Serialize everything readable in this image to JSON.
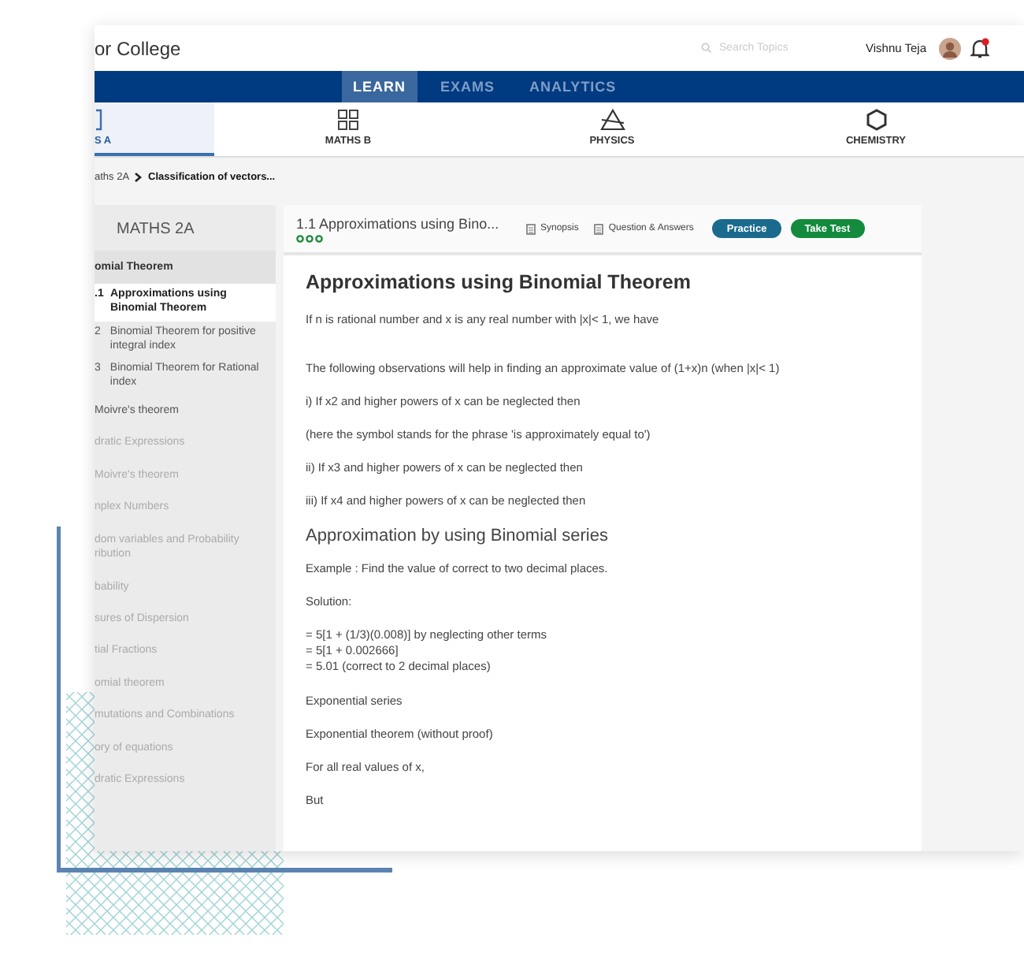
{
  "header": {
    "brand": "or College",
    "search": {
      "placeholder": "Search Topics"
    },
    "user": "Vishnu Teja",
    "notification": true
  },
  "nav_tabs": [
    {
      "label": "LEARN",
      "selected": true
    },
    {
      "label": "EXAMS",
      "selected": false
    },
    {
      "label": "ANALYTICS",
      "selected": false
    }
  ],
  "subjects": [
    {
      "label": "S A",
      "selected": true
    },
    {
      "label": "MATHS B",
      "selected": false
    },
    {
      "label": "PHYSICS",
      "selected": false
    },
    {
      "label": "CHEMISTRY",
      "selected": false
    }
  ],
  "breadcrumb": [
    "aths 2A",
    "Classification of vectors..."
  ],
  "sidebar": {
    "title": "MATHS 2A",
    "items": [
      {
        "label": "omial Theorem",
        "expanded": true,
        "children": [
          {
            "number": ".1",
            "label": "Approximations using Binomial Theorem",
            "selected": true
          },
          {
            "number": "2",
            "label": "Binomial Theorem for positive integral index",
            "selected": false
          },
          {
            "number": "3",
            "label": "Binomial Theorem for Rational index",
            "selected": false
          }
        ]
      },
      {
        "label": "Moivre's theorem",
        "expanded": false,
        "disabled": false
      },
      {
        "label": "dratic Expressions",
        "expanded": false,
        "disabled": true
      },
      {
        "label": "Moivre's theorem",
        "expanded": false,
        "disabled": true
      },
      {
        "label": "nplex Numbers",
        "expanded": false,
        "disabled": true
      },
      {
        "label": "dom variables and Probability",
        "label_2": "ribution",
        "expanded": false,
        "disabled": true
      },
      {
        "label": "bability",
        "expanded": false,
        "disabled": true
      },
      {
        "label": "sures of Dispersion",
        "expanded": false,
        "disabled": true
      },
      {
        "label": "tial Fractions",
        "expanded": false,
        "disabled": true
      },
      {
        "label": "omial theorem",
        "expanded": false,
        "disabled": true
      },
      {
        "label": "mutations and Combinations",
        "expanded": false,
        "disabled": true
      },
      {
        "label": "ory of equations",
        "expanded": false,
        "disabled": true
      },
      {
        "label": "dratic Expressions",
        "expanded": false,
        "disabled": true
      }
    ]
  },
  "lesson": {
    "title": "1.1 Approximations using Bino...",
    "links": [
      "Synopsis",
      "Question & Answers"
    ],
    "buttons": [
      {
        "label": "Practice",
        "kind": "practice"
      },
      {
        "label": "Take Test",
        "kind": "test"
      }
    ],
    "content": [
      {
        "kind": "h1",
        "text": "Approximations using Binomial Theorem"
      },
      {
        "kind": "p",
        "text": "If n is rational number and x is any real number with |x|< 1, we have"
      },
      {
        "kind": "p",
        "text": "The following observations will help in finding an approximate value of (1+x)n (when |x|< 1)"
      },
      {
        "kind": "p",
        "text": "i) If x2 and higher powers of x can be neglected then"
      },
      {
        "kind": "p",
        "text": "(here the symbol  stands for the phrase 'is approximately equal to')"
      },
      {
        "kind": "p",
        "text": "ii) If x3 and higher powers of x can be neglected then"
      },
      {
        "kind": "p",
        "text": "iii) If x4 and higher powers of x can be neglected then"
      },
      {
        "kind": "h2",
        "text": "Approximation by using Binomial series"
      },
      {
        "kind": "p",
        "text": "Example : Find the value of  correct to two decimal places."
      },
      {
        "kind": "p",
        "text": "Solution:"
      },
      {
        "kind": "lines",
        "lines": [
          "= 5[1 + (1/3)(0.008)] by neglecting other terms",
          "= 5[1 + 0.002666]",
          "= 5.01 (correct to 2 decimal places)"
        ]
      },
      {
        "kind": "p",
        "text": "Exponential series"
      },
      {
        "kind": "p",
        "text": "Exponential theorem (without proof)"
      },
      {
        "kind": "p",
        "text": "For all real values of x,"
      },
      {
        "kind": "p",
        "text": "But"
      }
    ]
  }
}
